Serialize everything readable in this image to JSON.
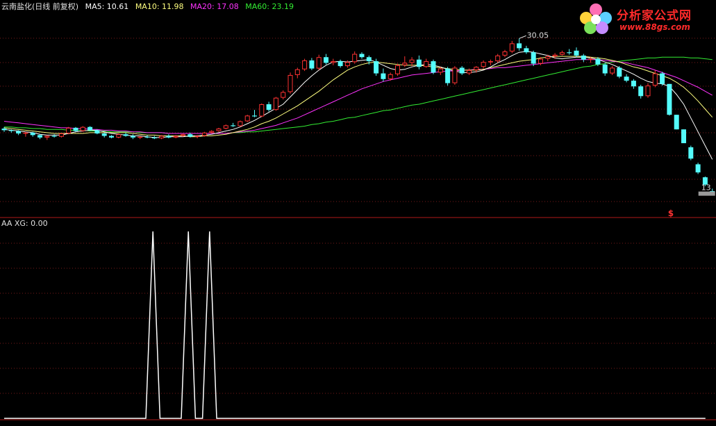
{
  "main_panel": {
    "stock_name": "云南盐化(日线 前复权)",
    "indicators": [
      {
        "label": "MA5: 10.61",
        "color": "#ffffff"
      },
      {
        "label": "MA10: 11.98",
        "color": "#ffff80"
      },
      {
        "label": "MA20: 17.08",
        "color": "#ff33ff"
      },
      {
        "label": "MA60: 23.19",
        "color": "#33ee33"
      }
    ],
    "high_label": "30.05",
    "low_label": "13",
    "marker_label": "$"
  },
  "sub_panel": {
    "title": "AA XG: 0.00"
  },
  "logo": {
    "title": "分析家公式网",
    "url": "www.88gs.com"
  },
  "colors": {
    "up": "#ff3232",
    "down": "#54fcfc",
    "ma5": "#ffffff",
    "ma10": "#ffff80",
    "ma20": "#ff33ff",
    "ma60": "#33ee33",
    "grid": "#7a1a1a",
    "xg": "#ffffff"
  },
  "chart_data": [
    {
      "type": "candlestick",
      "ylim": [
        10,
        35
      ],
      "candles": [
        [
          20.7,
          20.9,
          20.3,
          20.5
        ],
        [
          20.5,
          20.6,
          20.2,
          20.4
        ],
        [
          20.4,
          20.5,
          19.9,
          20.1
        ],
        [
          20.1,
          20.3,
          19.7,
          20.2
        ],
        [
          20.2,
          20.3,
          19.7,
          19.9
        ],
        [
          19.9,
          20.0,
          19.4,
          19.6
        ],
        [
          19.6,
          19.9,
          19.3,
          19.8
        ],
        [
          19.8,
          20.0,
          19.6,
          19.7
        ],
        [
          19.7,
          20.2,
          19.6,
          20.1
        ],
        [
          20.1,
          20.9,
          20.0,
          20.8
        ],
        [
          20.8,
          20.9,
          20.3,
          20.4
        ],
        [
          20.4,
          21.0,
          20.3,
          20.9
        ],
        [
          20.9,
          21.0,
          20.4,
          20.5
        ],
        [
          20.5,
          20.6,
          20.0,
          20.1
        ],
        [
          20.1,
          20.2,
          19.6,
          19.8
        ],
        [
          19.8,
          19.9,
          19.5,
          19.6
        ],
        [
          19.6,
          20.1,
          19.5,
          20.0
        ],
        [
          20.0,
          20.2,
          19.7,
          19.8
        ],
        [
          19.8,
          20.0,
          19.4,
          19.6
        ],
        [
          19.6,
          19.8,
          19.4,
          19.7
        ],
        [
          19.7,
          19.9,
          19.5,
          19.6
        ],
        [
          19.6,
          19.8,
          19.4,
          19.5
        ],
        [
          19.5,
          19.9,
          19.4,
          19.8
        ],
        [
          19.8,
          20.0,
          19.5,
          19.6
        ],
        [
          19.6,
          19.9,
          19.5,
          19.8
        ],
        [
          19.8,
          20.1,
          19.7,
          20.0
        ],
        [
          20.0,
          20.2,
          19.6,
          19.7
        ],
        [
          19.7,
          19.9,
          19.5,
          19.8
        ],
        [
          19.8,
          20.3,
          19.7,
          20.2
        ],
        [
          20.2,
          20.5,
          20.1,
          20.4
        ],
        [
          20.4,
          20.8,
          20.3,
          20.7
        ],
        [
          20.7,
          21.2,
          20.6,
          21.1
        ],
        [
          21.1,
          21.4,
          20.9,
          21.0
        ],
        [
          21.0,
          21.7,
          20.9,
          21.6
        ],
        [
          21.6,
          22.4,
          21.5,
          22.3
        ],
        [
          22.3,
          23.0,
          22.1,
          22.2
        ],
        [
          22.2,
          23.8,
          22.1,
          23.7
        ],
        [
          23.7,
          24.0,
          22.8,
          23.0
        ],
        [
          23.0,
          24.6,
          22.9,
          24.5
        ],
        [
          24.5,
          25.4,
          24.3,
          25.2
        ],
        [
          25.2,
          27.6,
          25.0,
          27.3
        ],
        [
          27.3,
          28.2,
          26.9,
          28.0
        ],
        [
          28.0,
          29.3,
          27.8,
          29.1
        ],
        [
          29.1,
          29.4,
          27.9,
          28.1
        ],
        [
          28.1,
          29.8,
          27.9,
          29.5
        ],
        [
          29.5,
          29.9,
          28.6,
          28.8
        ],
        [
          28.8,
          29.3,
          28.5,
          29.0
        ],
        [
          29.0,
          29.2,
          28.2,
          28.4
        ],
        [
          28.4,
          29.1,
          28.2,
          28.9
        ],
        [
          28.9,
          30.2,
          28.7,
          29.9
        ],
        [
          29.9,
          30.1,
          29.3,
          29.5
        ],
        [
          29.5,
          29.7,
          28.6,
          29.0
        ],
        [
          29.0,
          29.3,
          27.2,
          27.5
        ],
        [
          27.5,
          28.1,
          26.5,
          26.8
        ],
        [
          26.8,
          27.6,
          26.6,
          27.4
        ],
        [
          27.4,
          28.7,
          27.2,
          28.5
        ],
        [
          28.5,
          29.6,
          28.3,
          28.8
        ],
        [
          28.8,
          29.5,
          28.4,
          29.2
        ],
        [
          29.2,
          29.7,
          28.0,
          28.3
        ],
        [
          28.3,
          29.3,
          28.2,
          29.0
        ],
        [
          29.0,
          29.2,
          27.4,
          27.6
        ],
        [
          27.6,
          28.3,
          27.3,
          28.1
        ],
        [
          28.1,
          28.3,
          26.0,
          26.3
        ],
        [
          26.3,
          28.4,
          26.1,
          28.2
        ],
        [
          28.2,
          28.4,
          27.3,
          27.5
        ],
        [
          27.5,
          28.1,
          27.3,
          27.9
        ],
        [
          27.9,
          28.4,
          27.6,
          28.3
        ],
        [
          28.3,
          29.1,
          28.1,
          28.9
        ],
        [
          28.9,
          29.2,
          28.5,
          29.0
        ],
        [
          29.0,
          29.9,
          28.8,
          29.7
        ],
        [
          29.7,
          30.4,
          29.5,
          30.2
        ],
        [
          30.2,
          31.5,
          30.0,
          31.2
        ],
        [
          31.2,
          31.8,
          30.3,
          30.6
        ],
        [
          30.6,
          30.9,
          29.9,
          30.1
        ],
        [
          30.1,
          30.3,
          28.4,
          28.7
        ],
        [
          28.7,
          29.5,
          28.5,
          29.3
        ],
        [
          29.3,
          29.8,
          29.0,
          29.6
        ],
        [
          29.6,
          30.0,
          29.3,
          29.8
        ],
        [
          29.8,
          30.3,
          29.7,
          30.1
        ],
        [
          30.1,
          30.5,
          29.8,
          30.0
        ],
        [
          30.3,
          30.7,
          29.5,
          29.7
        ],
        [
          29.7,
          29.9,
          28.9,
          29.2
        ],
        [
          29.2,
          29.5,
          28.8,
          29.3
        ],
        [
          29.3,
          29.5,
          28.4,
          28.6
        ],
        [
          28.6,
          28.8,
          27.2,
          27.5
        ],
        [
          27.5,
          28.4,
          27.3,
          28.2
        ],
        [
          28.2,
          28.4,
          26.9,
          27.1
        ],
        [
          27.1,
          27.4,
          26.4,
          26.6
        ],
        [
          26.6,
          26.8,
          25.6,
          25.9
        ],
        [
          25.9,
          26.1,
          24.4,
          24.7
        ],
        [
          24.7,
          26.3,
          24.5,
          26.0
        ],
        [
          26.0,
          27.9,
          25.8,
          27.5
        ],
        [
          27.5,
          27.7,
          26.0,
          26.2
        ],
        [
          26.2,
          26.2,
          22.3,
          22.4
        ],
        [
          22.4,
          22.4,
          20.6,
          20.6
        ],
        [
          20.6,
          20.6,
          18.9,
          18.9
        ],
        [
          18.4,
          18.6,
          16.8,
          17.0
        ],
        [
          16.3,
          16.5,
          15.1,
          15.3
        ],
        [
          14.7,
          14.8,
          13.6,
          13.8
        ],
        [
          13.0,
          13.3,
          12.6,
          12.9
        ]
      ],
      "ma5": [
        20.6,
        20.5,
        20.4,
        20.3,
        20.2,
        20.0,
        19.9,
        19.9,
        19.9,
        20.1,
        20.3,
        20.4,
        20.5,
        20.5,
        20.3,
        20.1,
        20.0,
        19.9,
        19.8,
        19.8,
        19.7,
        19.6,
        19.6,
        19.7,
        19.7,
        19.7,
        19.8,
        19.8,
        19.9,
        20.0,
        20.2,
        20.4,
        20.6,
        20.9,
        21.3,
        21.7,
        22.2,
        22.7,
        23.2,
        23.7,
        24.6,
        25.5,
        26.4,
        27.2,
        27.9,
        28.5,
        28.9,
        29.0,
        28.9,
        29.0,
        29.1,
        29.2,
        28.9,
        28.5,
        28.1,
        27.9,
        28.0,
        28.3,
        28.5,
        28.6,
        28.5,
        28.3,
        28.0,
        27.8,
        27.6,
        27.6,
        27.7,
        27.9,
        28.3,
        28.8,
        29.2,
        29.7,
        30.1,
        30.2,
        30.1,
        29.9,
        29.7,
        29.4,
        29.3,
        29.4,
        29.5,
        29.5,
        29.4,
        29.2,
        28.9,
        28.6,
        28.2,
        27.8,
        27.4,
        26.9,
        26.5,
        26.3,
        26.2,
        25.9,
        24.9,
        23.7,
        22.0,
        20.3,
        18.6,
        16.9
      ],
      "ma10": [
        20.8,
        20.7,
        20.6,
        20.5,
        20.4,
        20.3,
        20.2,
        20.1,
        20.1,
        20.1,
        20.1,
        20.1,
        20.2,
        20.2,
        20.2,
        20.2,
        20.2,
        20.2,
        20.1,
        20.0,
        19.9,
        19.9,
        19.8,
        19.8,
        19.8,
        19.8,
        19.7,
        19.7,
        19.8,
        19.8,
        19.9,
        20.0,
        20.2,
        20.4,
        20.6,
        20.9,
        21.3,
        21.6,
        22.0,
        22.5,
        23.0,
        23.5,
        24.1,
        24.7,
        25.3,
        26.0,
        26.7,
        27.3,
        27.9,
        28.3,
        28.6,
        28.8,
        28.9,
        28.8,
        28.7,
        28.6,
        28.5,
        28.5,
        28.5,
        28.4,
        28.3,
        28.2,
        28.1,
        28.0,
        27.9,
        27.9,
        27.9,
        28.0,
        28.2,
        28.4,
        28.6,
        28.8,
        29.0,
        29.1,
        29.2,
        29.4,
        29.5,
        29.6,
        29.6,
        29.6,
        29.6,
        29.6,
        29.5,
        29.4,
        29.3,
        29.1,
        28.9,
        28.6,
        28.3,
        28.1,
        27.8,
        27.5,
        27.2,
        26.9,
        26.4,
        25.8,
        25.0,
        24.1,
        23.1,
        22.1
      ],
      "ma20": [
        21.6,
        21.5,
        21.4,
        21.3,
        21.2,
        21.1,
        21.0,
        20.9,
        20.8,
        20.8,
        20.7,
        20.7,
        20.6,
        20.6,
        20.5,
        20.5,
        20.4,
        20.4,
        20.3,
        20.3,
        20.2,
        20.2,
        20.2,
        20.1,
        20.1,
        20.1,
        20.1,
        20.1,
        20.1,
        20.1,
        20.1,
        20.1,
        20.2,
        20.3,
        20.4,
        20.5,
        20.7,
        20.9,
        21.1,
        21.4,
        21.7,
        22.0,
        22.4,
        22.8,
        23.2,
        23.6,
        24.0,
        24.4,
        24.8,
        25.2,
        25.6,
        25.9,
        26.2,
        26.5,
        26.7,
        26.9,
        27.1,
        27.3,
        27.4,
        27.5,
        27.6,
        27.7,
        27.8,
        27.8,
        27.9,
        27.9,
        28.0,
        28.0,
        28.1,
        28.2,
        28.2,
        28.3,
        28.4,
        28.5,
        28.6,
        28.7,
        28.8,
        28.9,
        29.0,
        29.1,
        29.2,
        29.2,
        29.2,
        29.2,
        29.1,
        29.0,
        28.9,
        28.8,
        28.6,
        28.4,
        28.2,
        27.9,
        27.6,
        27.3,
        27.0,
        26.6,
        26.2,
        25.8,
        25.3,
        24.8
      ],
      "ma60": [
        20.9,
        20.9,
        20.8,
        20.8,
        20.7,
        20.7,
        20.6,
        20.6,
        20.6,
        20.5,
        20.5,
        20.5,
        20.4,
        20.4,
        20.4,
        20.3,
        20.3,
        20.3,
        20.3,
        20.2,
        20.2,
        20.2,
        20.2,
        20.1,
        20.1,
        20.1,
        20.1,
        20.1,
        20.1,
        20.1,
        20.1,
        20.1,
        20.2,
        20.2,
        20.3,
        20.3,
        20.4,
        20.5,
        20.6,
        20.7,
        20.8,
        20.9,
        21.0,
        21.2,
        21.3,
        21.5,
        21.6,
        21.8,
        22.0,
        22.1,
        22.3,
        22.5,
        22.7,
        22.9,
        23.0,
        23.2,
        23.4,
        23.6,
        23.7,
        23.9,
        24.1,
        24.3,
        24.5,
        24.7,
        24.9,
        25.1,
        25.3,
        25.5,
        25.7,
        25.9,
        26.1,
        26.3,
        26.5,
        26.7,
        26.9,
        27.1,
        27.3,
        27.5,
        27.7,
        27.9,
        28.1,
        28.3,
        28.4,
        28.6,
        28.7,
        28.9,
        29.0,
        29.1,
        29.2,
        29.3,
        29.4,
        29.4,
        29.5,
        29.5,
        29.5,
        29.5,
        29.4,
        29.4,
        29.3,
        29.2
      ]
    },
    {
      "type": "line",
      "series": [
        {
          "name": "XG",
          "x": [
            0,
            20,
            21,
            22,
            23,
            25,
            26,
            27,
            28,
            29,
            30,
            31,
            99
          ],
          "values": [
            0,
            0,
            1,
            0,
            0,
            0,
            1,
            0,
            0,
            1,
            0,
            0,
            0
          ]
        }
      ],
      "ylim": [
        0,
        1
      ]
    }
  ]
}
